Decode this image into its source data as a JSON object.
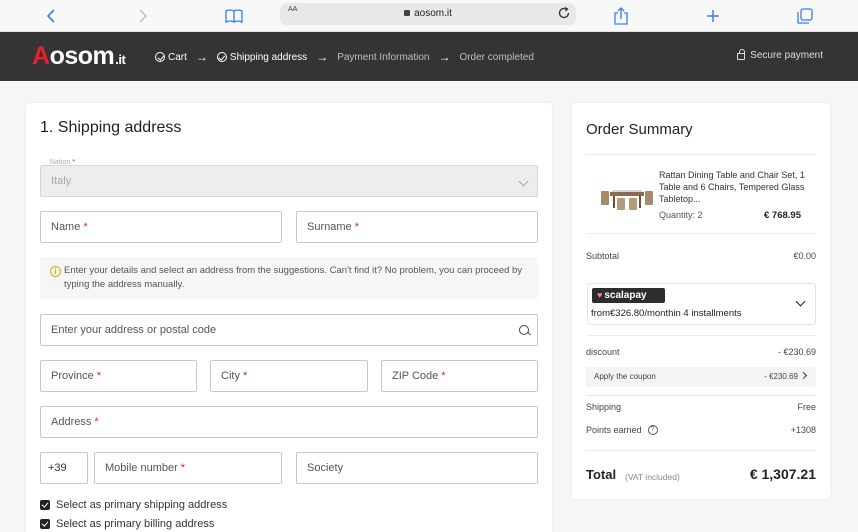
{
  "browser": {
    "url": "aosom.it",
    "text_size_label": "AA"
  },
  "header": {
    "logo_main": "Aosom",
    "logo_tld": ".it",
    "steps": [
      {
        "label": "Cart",
        "done": true
      },
      {
        "label": "Shipping address",
        "done": true
      },
      {
        "label": "Payment Information",
        "done": false
      },
      {
        "label": "Order completed",
        "done": false
      }
    ],
    "secure_label": "Secure payment"
  },
  "shipping": {
    "title": "1. Shipping address",
    "nation_label": "Nation",
    "nation_value": "Italy",
    "name_placeholder": "Name",
    "surname_placeholder": "Surname",
    "info_text": "Enter your details and select an address from the suggestions. Can't find it? No problem, you can proceed by typing the address manually.",
    "address_search_placeholder": "Enter your address or postal code",
    "province_placeholder": "Province",
    "city_placeholder": "City",
    "zip_placeholder": "ZIP Code",
    "address_placeholder": "Address",
    "phone_prefix": "+39",
    "mobile_placeholder": "Mobile number",
    "society_placeholder": "Society",
    "primary_shipping_label": "Select as primary shipping address",
    "primary_billing_label": "Select as primary billing address",
    "required_mark": "*"
  },
  "order": {
    "title": "Order Summary",
    "product_name": "Rattan Dining Table and Chair Set, 1 Table and 6 Chairs, Tempered Glass Tabletop...",
    "quantity_label": "Quantity: 2",
    "product_price": "€ 768.95",
    "subtotal_label": "Subtotal",
    "subtotal_value": "€0.00",
    "scalapay_brand": "scalapay",
    "scalapay_text": "from€326.80/monthin 4 installments",
    "discount_label": "discount",
    "discount_value": "- €230.69",
    "coupon_label": "Apply the coupon",
    "coupon_value": "- €230.69",
    "shipping_label": "Shipping",
    "shipping_value": "Free",
    "points_label": "Points earned",
    "points_value": "+1308",
    "total_label": "Total",
    "total_sub": "(VAT included)",
    "total_value": "€ 1,307.21"
  },
  "colors": {
    "brand_red": "#e62129",
    "header_dark": "#343434",
    "browser_blue": "#3b7cf5"
  }
}
